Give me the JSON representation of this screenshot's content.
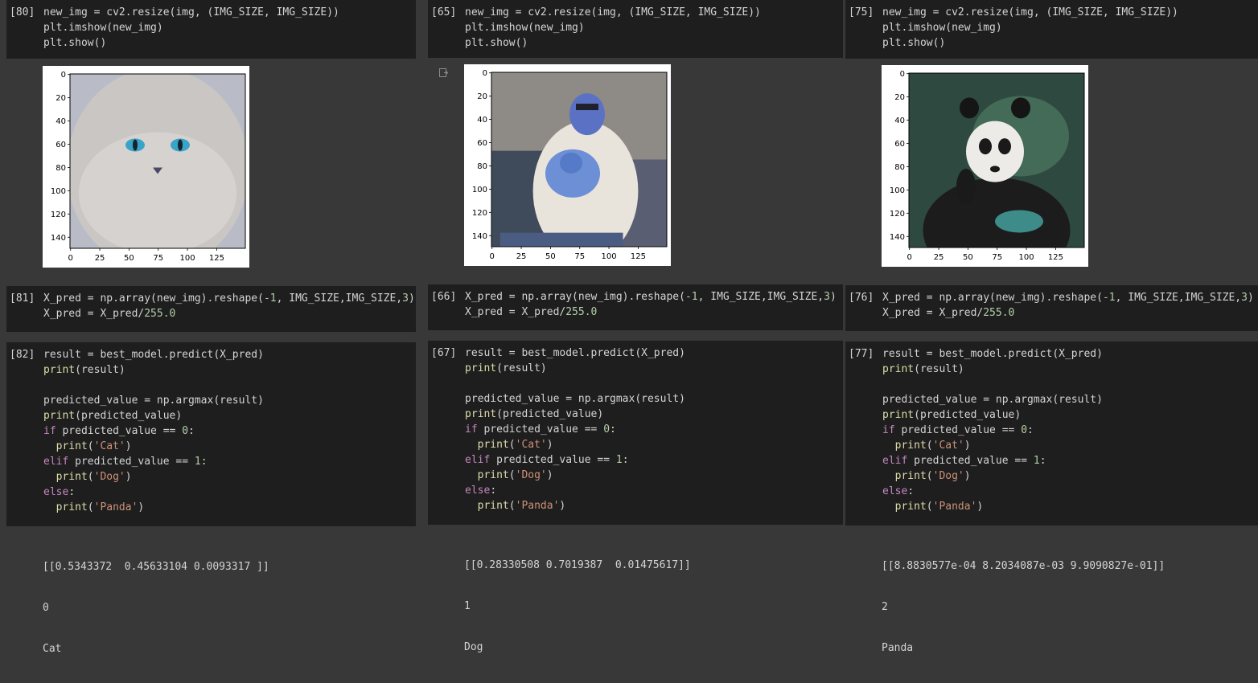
{
  "columns": [
    {
      "id": "cat",
      "cell_resize": {
        "prompt": "[80]",
        "lines": [
          [
            [
              "new_img = cv2.resize(img, (IMG_SIZE, IMG_SIZE))",
              "pl"
            ]
          ],
          [
            [
              "plt.imshow(new_img)",
              "pl"
            ]
          ],
          [
            [
              "plt.show()",
              "pl"
            ]
          ]
        ]
      },
      "plot": {
        "y_ticks": [
          "0",
          "20",
          "40",
          "60",
          "80",
          "100",
          "120",
          "140"
        ],
        "x_ticks": [
          "0",
          "25",
          "50",
          "75",
          "100",
          "125"
        ],
        "image_description_icon": "cat-photo"
      },
      "cell_reshape": {
        "prompt": "[81]",
        "lines": [
          [
            [
              "X_pred = np.array(new_img).reshape(",
              "pl"
            ],
            [
              "-1",
              "num"
            ],
            [
              ", IMG_SIZE,IMG_SIZE,",
              "pl"
            ],
            [
              "3",
              "num"
            ],
            [
              ")",
              "pl"
            ]
          ],
          [
            [
              "X_pred = X_pred/",
              "pl"
            ],
            [
              "255.0",
              "num"
            ]
          ]
        ]
      },
      "cell_predict": {
        "prompt": "[82]",
        "lines": [
          [
            [
              "result = best_model.predict(X_pred)",
              "pl"
            ]
          ],
          [
            [
              "print",
              "fn"
            ],
            [
              "(result)",
              "pl"
            ]
          ],
          [
            [
              "",
              "pl"
            ]
          ],
          [
            [
              "predicted_value = np.argmax(result)",
              "pl"
            ]
          ],
          [
            [
              "print",
              "fn"
            ],
            [
              "(predicted_value)",
              "pl"
            ]
          ],
          [
            [
              "if",
              "kw"
            ],
            [
              " predicted_value == ",
              "pl"
            ],
            [
              "0",
              "num"
            ],
            [
              ":",
              "pl"
            ]
          ],
          [
            [
              "  ",
              "pl"
            ],
            [
              "print",
              "fn"
            ],
            [
              "(",
              "pl"
            ],
            [
              "'Cat'",
              "str"
            ],
            [
              ")",
              "pl"
            ]
          ],
          [
            [
              "elif",
              "kw"
            ],
            [
              " predicted_value == ",
              "pl"
            ],
            [
              "1",
              "num"
            ],
            [
              ":",
              "pl"
            ]
          ],
          [
            [
              "  ",
              "pl"
            ],
            [
              "print",
              "fn"
            ],
            [
              "(",
              "pl"
            ],
            [
              "'Dog'",
              "str"
            ],
            [
              ")",
              "pl"
            ]
          ],
          [
            [
              "else",
              "kw"
            ],
            [
              ":",
              "pl"
            ]
          ],
          [
            [
              "  ",
              "pl"
            ],
            [
              "print",
              "fn"
            ],
            [
              "(",
              "pl"
            ],
            [
              "'Panda'",
              "str"
            ],
            [
              ")",
              "pl"
            ]
          ]
        ]
      },
      "output": {
        "result": "[[0.5343372  0.45633104 0.0093317 ]]",
        "index": "0",
        "label": "Cat"
      }
    },
    {
      "id": "dog",
      "cell_resize": {
        "prompt": "[65]",
        "lines": [
          [
            [
              "new_img = cv2.resize(img, (IMG_SIZE, IMG_SIZE))",
              "pl"
            ]
          ],
          [
            [
              "plt.imshow(new_img)",
              "pl"
            ]
          ],
          [
            [
              "plt.show()",
              "pl"
            ]
          ]
        ]
      },
      "plot": {
        "y_ticks": [
          "0",
          "20",
          "40",
          "60",
          "80",
          "100",
          "120",
          "140"
        ],
        "x_ticks": [
          "0",
          "25",
          "50",
          "75",
          "100",
          "125"
        ],
        "image_description_icon": "person-with-dog-photo"
      },
      "cell_reshape": {
        "prompt": "[66]",
        "lines": [
          [
            [
              "X_pred = np.array(new_img).reshape(",
              "pl"
            ],
            [
              "-1",
              "num"
            ],
            [
              ", IMG_SIZE,IMG_SIZE,",
              "pl"
            ],
            [
              "3",
              "num"
            ],
            [
              ")",
              "pl"
            ]
          ],
          [
            [
              "X_pred = X_pred/",
              "pl"
            ],
            [
              "255.0",
              "num"
            ]
          ]
        ]
      },
      "cell_predict": {
        "prompt": "[67]",
        "lines": [
          [
            [
              "result = best_model.predict(X_pred)",
              "pl"
            ]
          ],
          [
            [
              "print",
              "fn"
            ],
            [
              "(result)",
              "pl"
            ]
          ],
          [
            [
              "",
              "pl"
            ]
          ],
          [
            [
              "predicted_value = np.argmax(result)",
              "pl"
            ]
          ],
          [
            [
              "print",
              "fn"
            ],
            [
              "(predicted_value)",
              "pl"
            ]
          ],
          [
            [
              "if",
              "kw"
            ],
            [
              " predicted_value == ",
              "pl"
            ],
            [
              "0",
              "num"
            ],
            [
              ":",
              "pl"
            ]
          ],
          [
            [
              "  ",
              "pl"
            ],
            [
              "print",
              "fn"
            ],
            [
              "(",
              "pl"
            ],
            [
              "'Cat'",
              "str"
            ],
            [
              ")",
              "pl"
            ]
          ],
          [
            [
              "elif",
              "kw"
            ],
            [
              " predicted_value == ",
              "pl"
            ],
            [
              "1",
              "num"
            ],
            [
              ":",
              "pl"
            ]
          ],
          [
            [
              "  ",
              "pl"
            ],
            [
              "print",
              "fn"
            ],
            [
              "(",
              "pl"
            ],
            [
              "'Dog'",
              "str"
            ],
            [
              ")",
              "pl"
            ]
          ],
          [
            [
              "else",
              "kw"
            ],
            [
              ":",
              "pl"
            ]
          ],
          [
            [
              "  ",
              "pl"
            ],
            [
              "print",
              "fn"
            ],
            [
              "(",
              "pl"
            ],
            [
              "'Panda'",
              "str"
            ],
            [
              ")",
              "pl"
            ]
          ]
        ]
      },
      "output": {
        "result": "[[0.28330508 0.7019387  0.01475617]]",
        "index": "1",
        "label": "Dog"
      }
    },
    {
      "id": "panda",
      "cell_resize": {
        "prompt": "[75]",
        "lines": [
          [
            [
              "new_img = cv2.resize(img, (IMG_SIZE, IMG_SIZE))",
              "pl"
            ]
          ],
          [
            [
              "plt.imshow(new_img)",
              "pl"
            ]
          ],
          [
            [
              "plt.show()",
              "pl"
            ]
          ]
        ]
      },
      "plot": {
        "y_ticks": [
          "0",
          "20",
          "40",
          "60",
          "80",
          "100",
          "120",
          "140"
        ],
        "x_ticks": [
          "0",
          "25",
          "50",
          "75",
          "100",
          "125"
        ],
        "image_description_icon": "panda-photo"
      },
      "cell_reshape": {
        "prompt": "[76]",
        "lines": [
          [
            [
              "X_pred = np.array(new_img).reshape(",
              "pl"
            ],
            [
              "-1",
              "num"
            ],
            [
              ", IMG_SIZE,IMG_SIZE,",
              "pl"
            ],
            [
              "3",
              "num"
            ],
            [
              ")",
              "pl"
            ]
          ],
          [
            [
              "X_pred = X_pred/",
              "pl"
            ],
            [
              "255.0",
              "num"
            ]
          ]
        ]
      },
      "cell_predict": {
        "prompt": "[77]",
        "lines": [
          [
            [
              "result = best_model.predict(X_pred)",
              "pl"
            ]
          ],
          [
            [
              "print",
              "fn"
            ],
            [
              "(result)",
              "pl"
            ]
          ],
          [
            [
              "",
              "pl"
            ]
          ],
          [
            [
              "predicted_value = np.argmax(result)",
              "pl"
            ]
          ],
          [
            [
              "print",
              "fn"
            ],
            [
              "(predicted_value)",
              "pl"
            ]
          ],
          [
            [
              "if",
              "kw"
            ],
            [
              " predicted_value == ",
              "pl"
            ],
            [
              "0",
              "num"
            ],
            [
              ":",
              "pl"
            ]
          ],
          [
            [
              "  ",
              "pl"
            ],
            [
              "print",
              "fn"
            ],
            [
              "(",
              "pl"
            ],
            [
              "'Cat'",
              "str"
            ],
            [
              ")",
              "pl"
            ]
          ],
          [
            [
              "elif",
              "kw"
            ],
            [
              " predicted_value == ",
              "pl"
            ],
            [
              "1",
              "num"
            ],
            [
              ":",
              "pl"
            ]
          ],
          [
            [
              "  ",
              "pl"
            ],
            [
              "print",
              "fn"
            ],
            [
              "(",
              "pl"
            ],
            [
              "'Dog'",
              "str"
            ],
            [
              ")",
              "pl"
            ]
          ],
          [
            [
              "else",
              "kw"
            ],
            [
              ":",
              "pl"
            ]
          ],
          [
            [
              "  ",
              "pl"
            ],
            [
              "print",
              "fn"
            ],
            [
              "(",
              "pl"
            ],
            [
              "'Panda'",
              "str"
            ],
            [
              ")",
              "pl"
            ]
          ]
        ]
      },
      "output": {
        "result": "[[8.8830577e-04 8.2034087e-03 9.9090827e-01]]",
        "index": "2",
        "label": "Panda"
      }
    }
  ],
  "colors": {
    "background": "#383838",
    "cell": "#1e1e1e",
    "keyword": "#c586c0",
    "function": "#dcdcaa",
    "number": "#b5cea8",
    "string": "#ce9178"
  }
}
